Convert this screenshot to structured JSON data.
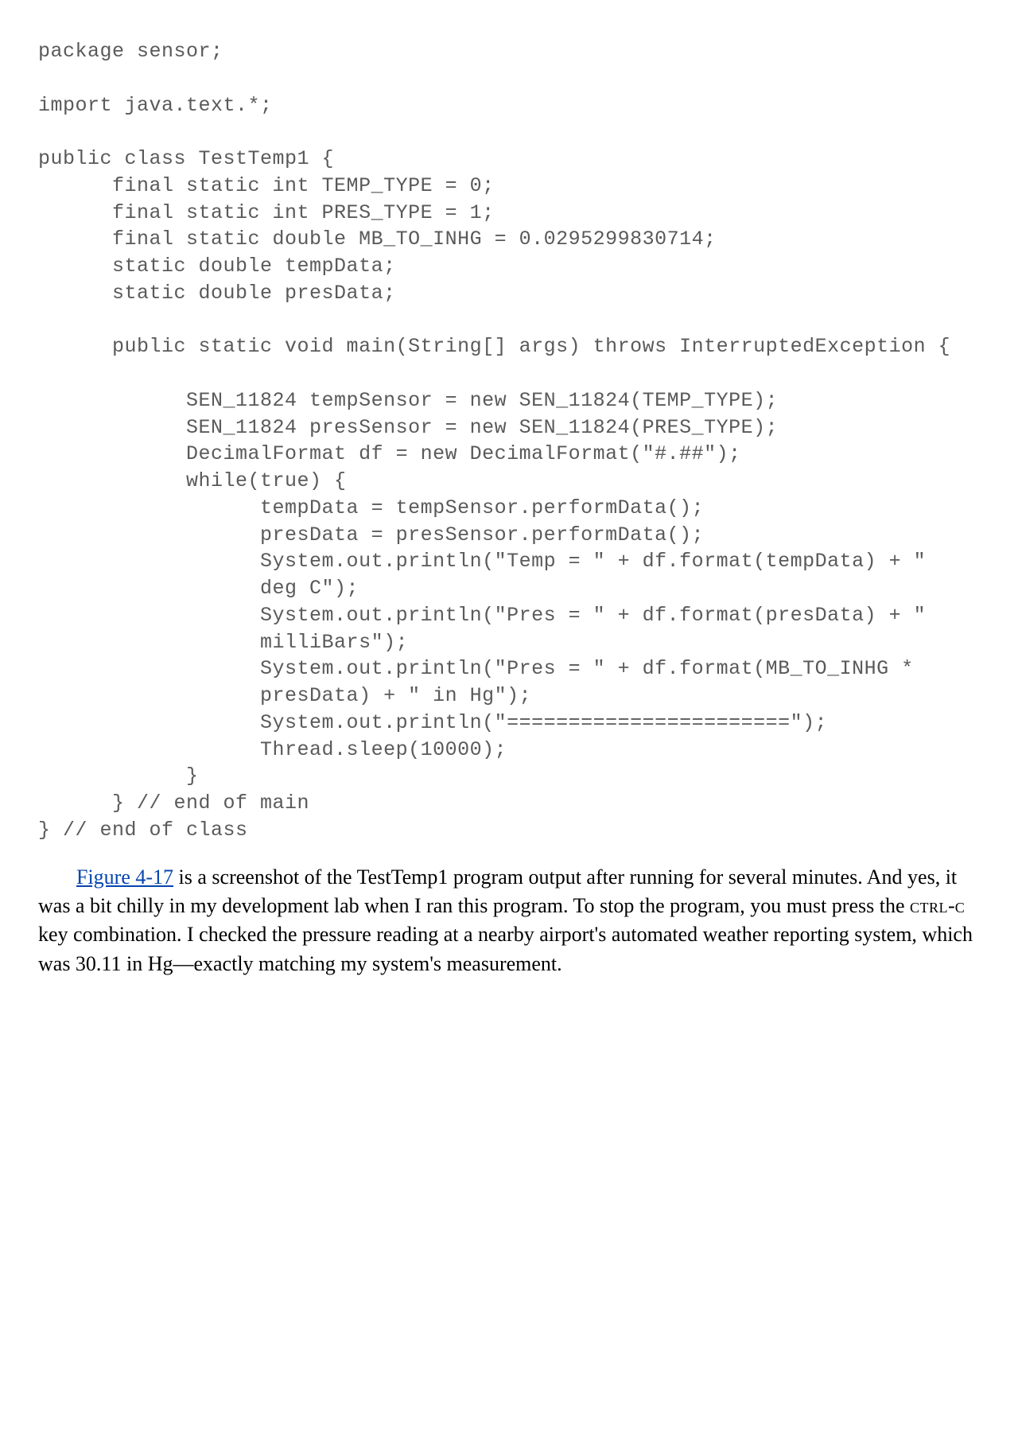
{
  "code": {
    "l01": "package sensor;",
    "l02": "",
    "l03": "import java.text.*;",
    "l04": "",
    "l05": "public class TestTemp1 {",
    "l06": "      final static int TEMP_TYPE = 0;",
    "l07": "      final static int PRES_TYPE = 1;",
    "l08": "      final static double MB_TO_INHG = 0.0295299830714;",
    "l09": "      static double tempData;",
    "l10": "      static double presData;",
    "l11": "",
    "l12": "      public static void main(String[] args) throws InterruptedException {",
    "l13": "",
    "l14": "            SEN_11824 tempSensor = new SEN_11824(TEMP_TYPE);",
    "l15": "            SEN_11824 presSensor = new SEN_11824(PRES_TYPE);",
    "l16": "            DecimalFormat df = new DecimalFormat(\"#.##\");",
    "l17": "            while(true) {",
    "l18": "                  tempData = tempSensor.performData();",
    "l19": "                  presData = presSensor.performData();",
    "l20": "                  System.out.println(\"Temp = \" + df.format(tempData) + \"",
    "l21": "                  deg C\");",
    "l22": "                  System.out.println(\"Pres = \" + df.format(presData) + \"",
    "l23": "                  milliBars\");",
    "l24": "                  System.out.println(\"Pres = \" + df.format(MB_TO_INHG *",
    "l25": "                  presData) + \" in Hg\");",
    "l26": "                  System.out.println(\"=======================\");",
    "l27": "                  Thread.sleep(10000);",
    "l28": "            }",
    "l29": "      } // end of main",
    "l30": "} // end of class"
  },
  "para": {
    "link": "Figure 4-17",
    "part1": " is a screenshot of the TestTemp1 program output after running for several minutes. And yes, it was a bit chilly in my development lab when I ran this program. To stop the program, you must press the ",
    "ctrlc_pre": "ctrl",
    "ctrlc_dash": "-",
    "ctrlc_post": "c",
    "part2": " key combination. I checked the pressure reading at a nearby airport's automated weather reporting system, which was 30.11 in Hg—exactly matching my system's measurement."
  }
}
